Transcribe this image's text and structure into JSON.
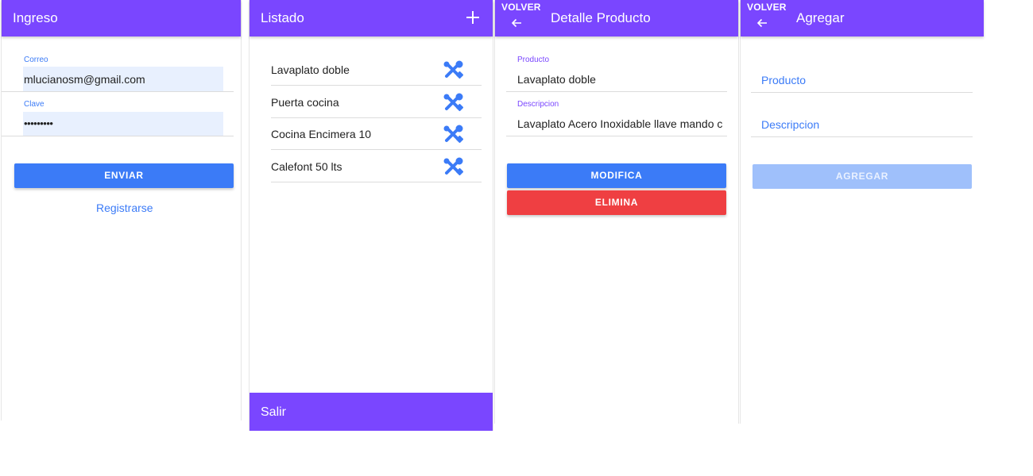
{
  "colors": {
    "toolbar": "#7a46ff",
    "primary": "#3b7bf7",
    "danger": "#ef3f42",
    "disabled": "#9fc0fb",
    "autofill": "#e8f0fe"
  },
  "login": {
    "title": "Ingreso",
    "email_label": "Correo",
    "email_value": "mlucianosm@gmail.com",
    "password_label": "Clave",
    "password_value": "•••••••••",
    "submit_label": "ENVIAR",
    "register_link": "Registrarse"
  },
  "list": {
    "title": "Listado",
    "add_icon": "plus-icon",
    "row_icon": "tools-icon",
    "items": [
      {
        "label": "Lavaplato doble"
      },
      {
        "label": "Puerta cocina"
      },
      {
        "label": "Cocina Encimera 10"
      },
      {
        "label": "Calefont 50 lts"
      }
    ],
    "footer_label": "Salir"
  },
  "detail": {
    "back_label": "VOLVER",
    "title": "Detalle Producto",
    "product_label": "Producto",
    "product_value": "Lavaplato doble",
    "description_label": "Descripcion",
    "description_value": "Lavaplato Acero Inoxidable llave mando c",
    "modify_label": "MODIFICA",
    "delete_label": "ELIMINA"
  },
  "add": {
    "back_label": "VOLVER",
    "title": "Agregar",
    "product_placeholder": "Producto",
    "description_placeholder": "Descripcion",
    "submit_label": "AGREGAR"
  }
}
